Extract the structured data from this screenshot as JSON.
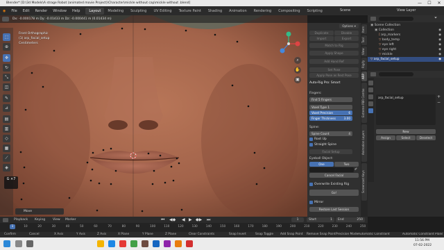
{
  "window": {
    "title": "Blender* [D:\\3d Models\\A strage Robot (animated movie Project)\\Character\\mickle without cap\\mickle without .blend]",
    "minimize": "—",
    "maximize": "☐",
    "close": "✕"
  },
  "menu": {
    "items": [
      "File",
      "Edit",
      "Render",
      "Window",
      "Help"
    ],
    "workspaces": [
      "Layout",
      "Modeling",
      "Sculpting",
      "UV Editing",
      "Texture Paint",
      "Shading",
      "Animation",
      "Rendering",
      "Compositing",
      "Scripting"
    ],
    "active_workspace": "Layout",
    "scene_label": "Scene",
    "view_layer_label": "View Layer"
  },
  "viewport": {
    "header_text": "Dx: -0.000178 m  Dy: -0.01433 m  Dz: -0.000441 m (0.01434 m)",
    "overlay_line1": "Front Orthographic",
    "overlay_line2": "(1) arp_facial_setup",
    "overlay_line3": "Centimeters",
    "key_hint": "G ×7",
    "move_label": "Move"
  },
  "npanel": {
    "btn_duplicate": "Duplicate",
    "btn_disable": "Disable",
    "btn_import": "Import",
    "btn_export": "Export",
    "btn_match_rig": "Match to Rig",
    "btn_apply_shape": "Apply Shape",
    "btn_add_hand_ref": "Add Hand Ref",
    "btn_set_pose": "Set Pose",
    "btn_apply_pose": "Apply Pose as Rest Pose",
    "section_title": "Auto-Rig Pro: Smart",
    "fingers_label": "Fingers:",
    "fingers_value": "Find 5 Fingers",
    "voxel_type": "Voxel Type 1",
    "voxel_precision_label": "Voxel Precision",
    "voxel_precision_value": "6",
    "finger_thickness_label": "Finger Thickness",
    "finger_thickness_value": "3.00",
    "spine_label": "Spine:",
    "spine_count_label": "Spine Count",
    "spine_count_value": "4",
    "root_up": "Root Up",
    "straight_spine": "Straight Spine",
    "facial_setup": "Facial Setup",
    "eyeball_label": "Eyeball Object:",
    "eyeball_one": "One",
    "eyeball_two": "Two",
    "cancel_facial": "Cancel Facial",
    "overwrite_rig": "Overwrite Existing Rig",
    "go": "Go!",
    "mirror": "Mirror",
    "restore_session": "Restore Last Session"
  },
  "sidetabs": [
    "Item",
    "Tool",
    "View",
    "Rigify",
    "ARP",
    "Extreme PBR Combo",
    "Animation Layers",
    "Screencast Keys"
  ],
  "outliner": {
    "title": "Scene Collection",
    "rows": [
      "Collection",
      "arp_markers",
      "body_temp",
      "eye left",
      "eye right",
      "mickle",
      "arp_facial_setup"
    ],
    "selected": "arp_facial_setup"
  },
  "properties": {
    "field_value": "arp_facial_setup",
    "btn_new": "New",
    "btn_assign": "Assign",
    "btn_select": "Select",
    "btn_deselect": "Deselect"
  },
  "timeline": {
    "menus": [
      "Playback",
      "Keying",
      "View",
      "Marker"
    ],
    "current_frame": "1",
    "start_label": "Start",
    "start_value": "1",
    "end_label": "End",
    "end_value": "250",
    "ticks": [
      "10",
      "20",
      "30",
      "40",
      "50",
      "60",
      "70",
      "80",
      "90",
      "100",
      "110",
      "120",
      "130",
      "140",
      "150",
      "160",
      "170",
      "180",
      "190",
      "200",
      "210",
      "220",
      "230",
      "240",
      "250"
    ]
  },
  "status": {
    "items": [
      "Confirm",
      "Cancel",
      "X Axis",
      "Y Axis",
      "Z Axis",
      "X Plane",
      "Y Plane",
      "Z Plane",
      "Clear Constraints",
      "Snap Invert",
      "Snap Toggle",
      "Add Snap Point",
      "Remove Snap Point",
      "Precision Mode",
      "Automatic Constraint",
      "Automatic Constraint Plane"
    ]
  },
  "taskbar": {
    "time": "11:56 PM",
    "date": "07-02-2022"
  },
  "colors": {
    "accent": "#4772b3",
    "skin": "#a86a50",
    "vertex": "#111111"
  }
}
